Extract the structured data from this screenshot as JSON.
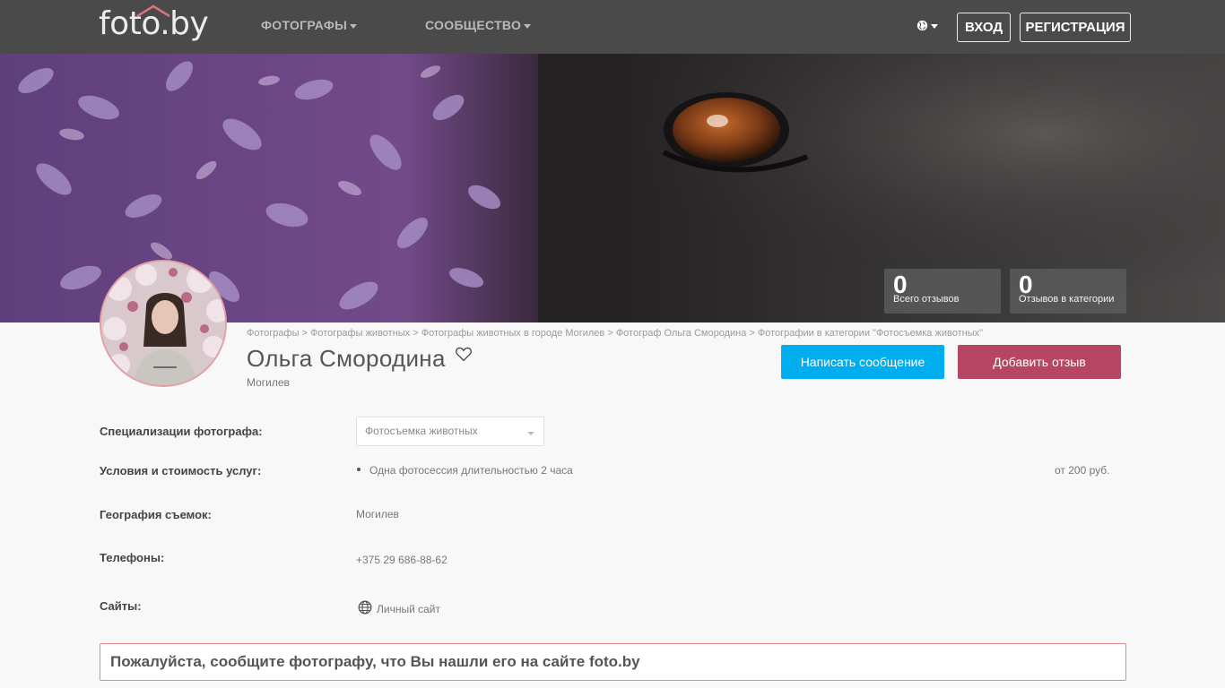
{
  "header": {
    "logo": "foto.by",
    "nav": [
      {
        "label": "ФОТОГРАФЫ"
      },
      {
        "label": "СООБЩЕСТВО"
      }
    ],
    "login_label": "ВХОД",
    "register_label": "РЕГИСТРАЦИЯ"
  },
  "stats": [
    {
      "value": "0",
      "label": "Всего отзывов"
    },
    {
      "value": "0",
      "label": "Отзывов в категории"
    }
  ],
  "breadcrumb": [
    "Фотографы",
    "Фотографы животных",
    "Фотографы животных в городе Могилев",
    "Фотограф Ольга Смородина",
    "Фотографии в категории \"Фотосъемка животных\""
  ],
  "breadcrumb_separator": " > ",
  "profile": {
    "name": "Ольга Смородина",
    "city": "Могилев"
  },
  "actions": {
    "message_label": "Написать сообщение",
    "review_label": "Добавить отзыв"
  },
  "details": {
    "specializations_label": "Специализации фотографа:",
    "specialization_selected": "Фотосъемка животных",
    "services_label": "Условия и стоимость услуг:",
    "service_item": "Одна фотосессия длительностью 2 часа",
    "service_price": "от 200 руб.",
    "geography_label": "География съемок:",
    "geography_value": "Могилев",
    "phones_label": "Телефоны:",
    "phone_value": "+375 29 686-88-62",
    "sites_label": "Сайты:",
    "site_value": "Личный сайт"
  },
  "notice": "Пожалуйста, сообщите фотографу, что Вы нашли его на сайте foto.by",
  "colors": {
    "nav_bg": "#4a4a4a",
    "primary_blue": "#00aeef",
    "rose": "#b74665",
    "notice_border": "#e2898c"
  }
}
